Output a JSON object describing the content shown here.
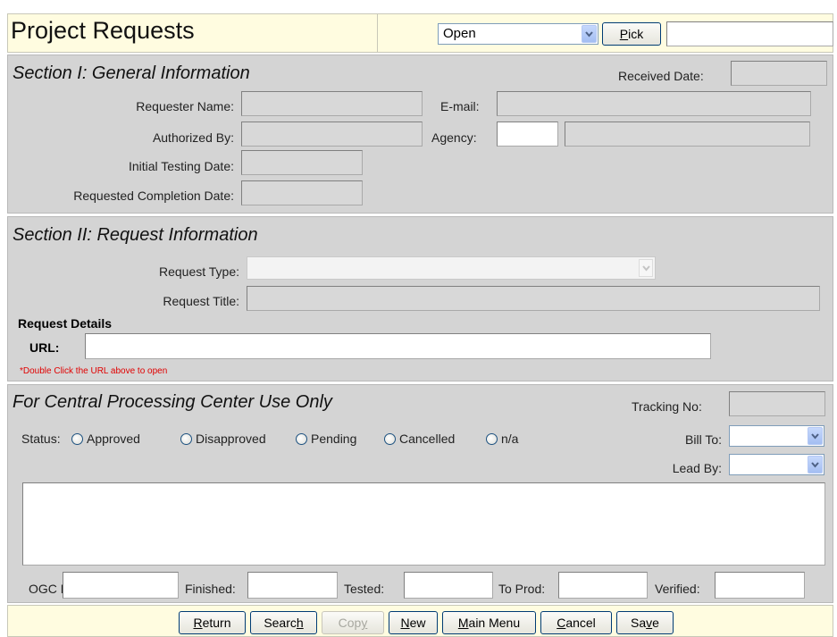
{
  "header": {
    "title": "Project Requests",
    "status_select": "Open",
    "pick_button": {
      "label_pre": "",
      "label_u": "P",
      "label_post": "ick"
    },
    "search_value": ""
  },
  "section1": {
    "title": "Section I: General Information",
    "received_date_label": "Received Date:",
    "requester_name_label": "Requester Name:",
    "email_label": "E-mail:",
    "authorized_by_label": "Authorized By:",
    "agency_label": "Agency:",
    "initial_testing_date_label": "Initial Testing Date:",
    "requested_completion_date_label": "Requested Completion Date:"
  },
  "section2": {
    "title": "Section II: Request Information",
    "request_type_label": "Request Type:",
    "request_title_label": "Request Title:",
    "request_details_label": "Request Details",
    "url_label": "URL:",
    "url_value": "",
    "url_hint": "*Double Click the URL above to open"
  },
  "section3": {
    "title": "For Central Processing Center Use Only",
    "tracking_no_label": "Tracking No:",
    "status_label": "Status:",
    "status_options": [
      "Approved",
      "Disapproved",
      "Pending",
      "Cancelled",
      "n/a"
    ],
    "bill_to_label": "Bill To:",
    "lead_by_label": "Lead By:",
    "notes_value": "",
    "date_fields": {
      "ogc_dt": "OGC Dt:",
      "finished": "Finished:",
      "tested": "Tested:",
      "to_prod": "To Prod:",
      "verified": "Verified:"
    }
  },
  "footer": {
    "buttons": {
      "return": {
        "pre": "",
        "u": "R",
        "post": "eturn"
      },
      "search": {
        "pre": "Searc",
        "u": "h",
        "post": ""
      },
      "copy": {
        "pre": "Cop",
        "u": "y",
        "post": ""
      },
      "new": {
        "pre": "",
        "u": "N",
        "post": "ew"
      },
      "main_menu": {
        "pre": "",
        "u": "M",
        "post": "ain Menu"
      },
      "cancel": {
        "pre": "",
        "u": "C",
        "post": "ancel"
      },
      "save": {
        "pre": "Sa",
        "u": "v",
        "post": "e"
      }
    }
  },
  "colors": {
    "header_bg": "#fffce0",
    "section_bg": "#d4d4d4",
    "hint_red": "#e00000",
    "button_border": "#003c74"
  }
}
